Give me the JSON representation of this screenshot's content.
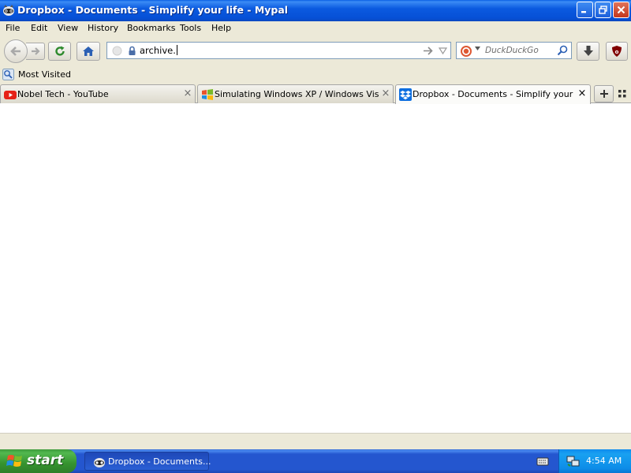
{
  "window": {
    "title": "Dropbox - Documents - Simplify your life - Mypal"
  },
  "menu": {
    "items": [
      {
        "label": "File"
      },
      {
        "label": "Edit"
      },
      {
        "label": "View"
      },
      {
        "label": "History"
      },
      {
        "label": "Bookmarks"
      },
      {
        "label": "Tools"
      },
      {
        "label": "Help"
      }
    ]
  },
  "navbar": {
    "url": "archive.",
    "search_placeholder": "DuckDuckGo"
  },
  "bookmarks": {
    "items": [
      {
        "label": "Most Visited",
        "icon": "most-visited-icon"
      }
    ]
  },
  "tabs": [
    {
      "label": "Nobel Tech - YouTube",
      "icon": "youtube-icon",
      "active": false
    },
    {
      "label": "Simulating Windows XP / Windows Vista /…",
      "icon": "windows-icon",
      "active": false
    },
    {
      "label": "Dropbox - Documents - Simplify your life",
      "icon": "dropbox-icon",
      "active": true
    }
  ],
  "taskbar": {
    "start_label": "start",
    "items": [
      {
        "label": "Dropbox - Documents..."
      }
    ],
    "clock": "4:54 AM"
  },
  "colors": {
    "titlebar": "#0650d6",
    "taskbar": "#2456cf",
    "start_button": "#35932f",
    "tray": "#0d8de8",
    "chrome": "#ece9d8"
  }
}
